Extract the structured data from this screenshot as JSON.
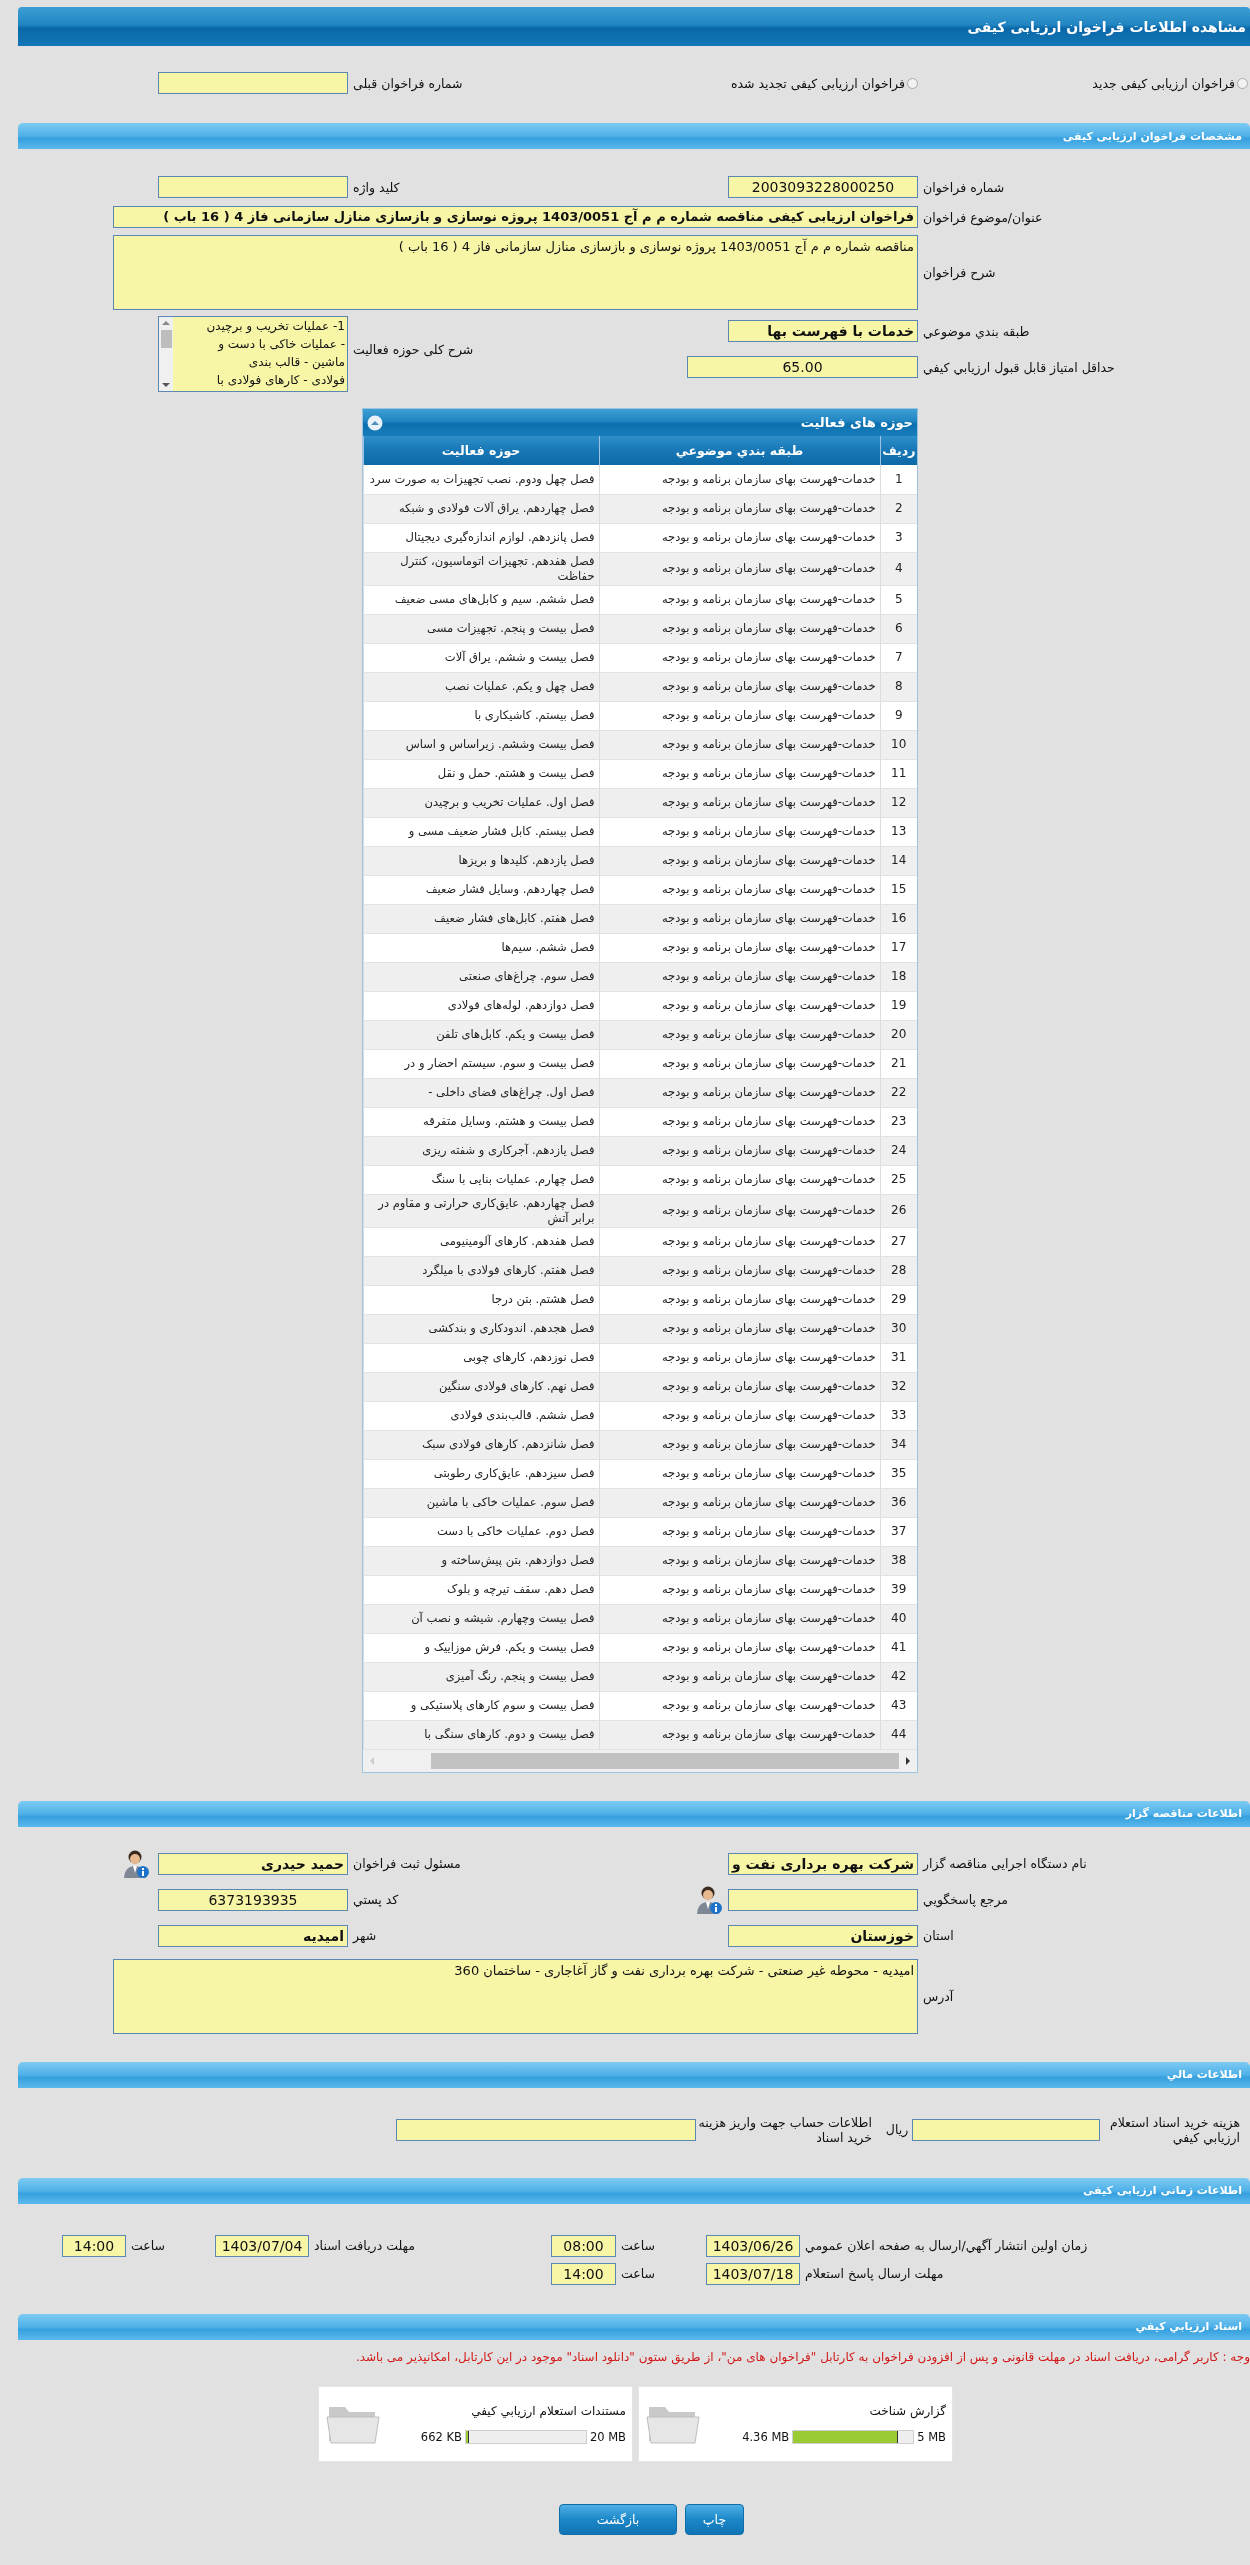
{
  "window": {
    "title": "مشاهده اطلاعات فراخوان ارزیابی کیفی"
  },
  "call_type": [
    {
      "label": "فراخوان ارزیابی کیفی جدید",
      "selected": false
    },
    {
      "label": "فراخوان ارزیابی کیفی تجدید شده",
      "selected": false
    }
  ],
  "previous_call": {
    "label": "شماره فراخوان قبلی"
  },
  "details": {
    "title": "مشخصات فراخوان ارزیابی کیفی",
    "call_number": {
      "label": "شماره فراخوان",
      "value": "2003093228000250"
    },
    "keyword": {
      "label": "کلید واژه"
    },
    "subject": {
      "label": "عنوان/موضوع فراخوان",
      "value": "فراخوان ارزیابی کیفی مناقصه شماره م م آج 1403/0051 پروژه نوسازی و بازسازی منازل سازمانی فاز 4 ( 16 باب )"
    },
    "description": {
      "label": "شرح فراخوان",
      "value": "مناقصه شماره م م آج 1403/0051 پروژه نوسازی و بازسازی منازل سازمانی فاز 4 ( 16 باب )"
    },
    "category": {
      "label": "طبقه بندي موضوعي",
      "value": "خدمات با فهرست بها"
    },
    "activity_summary": {
      "label": "شرح کلی حوزه فعالیت",
      "lines": [
        "1- عملیات تخریب و برچیدن",
        "- عملیات خاکی با دست و",
        "ماشین - قالب بندی",
        "فولادی - کارهای فولادی با"
      ]
    },
    "min_score": {
      "label": "حداقل امتياز قابل قبول ارزيابي کيفي",
      "value": "65.00"
    }
  },
  "activities": {
    "title": "حوزه های فعالیت",
    "columns": [
      "ردیف",
      "طبقه بندي موضوعي",
      "حوزه فعالیت"
    ],
    "rows": [
      [
        "1",
        "خدمات-فهرست بهای سازمان برنامه و بودجه",
        "فصل چهل ودوم. نصب تجهیزات به صورت سرد"
      ],
      [
        "2",
        "خدمات-فهرست بهای سازمان برنامه و بودجه",
        "فصل چهاردهم. یراق آلات فولادی و شبکه"
      ],
      [
        "3",
        "خدمات-فهرست بهای سازمان برنامه و بودجه",
        "فصل پانزدهم. لوازم اندازه‌گیری دیجیتال"
      ],
      [
        "4",
        "خدمات-فهرست بهای سازمان برنامه و بودجه",
        "فصل هفدهم. تجهیزات اتوماسیون، کنترل حفاظت"
      ],
      [
        "5",
        "خدمات-فهرست بهای سازمان برنامه و بودجه",
        "فصل ششم. سیم و کابل‌های مسی ضعیف"
      ],
      [
        "6",
        "خدمات-فهرست بهای سازمان برنامه و بودجه",
        "فصل بیست و پنجم. تجهیزات مسی"
      ],
      [
        "7",
        "خدمات-فهرست بهای سازمان برنامه و بودجه",
        "فصل بیست و ششم. یراق آلات"
      ],
      [
        "8",
        "خدمات-فهرست بهای سازمان برنامه و بودجه",
        "فصل چهل و یکم. عملیات نصب"
      ],
      [
        "9",
        "خدمات-فهرست بهای سازمان برنامه و بودجه",
        "فصل بیستم. کاشیکاری با"
      ],
      [
        "10",
        "خدمات-فهرست بهای سازمان برنامه و بودجه",
        "فصل بیست وششم. زیراساس و اساس"
      ],
      [
        "11",
        "خدمات-فهرست بهای سازمان برنامه و بودجه",
        "فصل بیست و هشتم. حمل و نقل"
      ],
      [
        "12",
        "خدمات-فهرست بهای سازمان برنامه و بودجه",
        "فصل اول. عملیات تخریب و برچیدن"
      ],
      [
        "13",
        "خدمات-فهرست بهای سازمان برنامه و بودجه",
        "فصل بیستم. کابل فشار ضعیف مسی و"
      ],
      [
        "14",
        "خدمات-فهرست بهای سازمان برنامه و بودجه",
        "فصل یازدهم. کلیدها و بریزها"
      ],
      [
        "15",
        "خدمات-فهرست بهای سازمان برنامه و بودجه",
        "فصل چهاردهم. وسایل فشار ضعیف"
      ],
      [
        "16",
        "خدمات-فهرست بهای سازمان برنامه و بودجه",
        "فصل هفتم. کابل‌های فشار ضعیف"
      ],
      [
        "17",
        "خدمات-فهرست بهای سازمان برنامه و بودجه",
        "فصل ششم. سیم‌ها"
      ],
      [
        "18",
        "خدمات-فهرست بهای سازمان برنامه و بودجه",
        "فصل سوم. چراغ‌های صنعتی"
      ],
      [
        "19",
        "خدمات-فهرست بهای سازمان برنامه و بودجه",
        "فصل دوازدهم. لوله‌های فولادی"
      ],
      [
        "20",
        "خدمات-فهرست بهای سازمان برنامه و بودجه",
        "فصل بیست و یکم. کابل‌های تلفن"
      ],
      [
        "21",
        "خدمات-فهرست بهای سازمان برنامه و بودجه",
        "فصل بیست و سوم. سیستم احضار و در"
      ],
      [
        "22",
        "خدمات-فهرست بهای سازمان برنامه و بودجه",
        "فصل اول. چراغ‌های فضای داخلی -"
      ],
      [
        "23",
        "خدمات-فهرست بهای سازمان برنامه و بودجه",
        "فصل بیست و هشتم. وسایل متفرقه"
      ],
      [
        "24",
        "خدمات-فهرست بهای سازمان برنامه و بودجه",
        "فصل یازدهم. آجرکاری و شفته ریزی"
      ],
      [
        "25",
        "خدمات-فهرست بهای سازمان برنامه و بودجه",
        "فصل چهارم. عملیات بنایی با سنگ"
      ],
      [
        "26",
        "خدمات-فهرست بهای سازمان برنامه و بودجه",
        "فصل چهاردهم. عایق‌کاری حرارتی و مقاوم در برابر آتش"
      ],
      [
        "27",
        "خدمات-فهرست بهای سازمان برنامه و بودجه",
        "فصل هفدهم. کارهای آلومینیومی"
      ],
      [
        "28",
        "خدمات-فهرست بهای سازمان برنامه و بودجه",
        "فصل هفتم. کارهای فولادی با میلگرد"
      ],
      [
        "29",
        "خدمات-فهرست بهای سازمان برنامه و بودجه",
        "فصل هشتم. بتن درجا"
      ],
      [
        "30",
        "خدمات-فهرست بهای سازمان برنامه و بودجه",
        "فصل هجدهم. اندودکاری و بندکشی"
      ],
      [
        "31",
        "خدمات-فهرست بهای سازمان برنامه و بودجه",
        "فصل نوزدهم. کارهای چوبی"
      ],
      [
        "32",
        "خدمات-فهرست بهای سازمان برنامه و بودجه",
        "فصل نهم. کارهای فولادی سنگین"
      ],
      [
        "33",
        "خدمات-فهرست بهای سازمان برنامه و بودجه",
        "فصل ششم. قالب‌بندی فولادی"
      ],
      [
        "34",
        "خدمات-فهرست بهای سازمان برنامه و بودجه",
        "فصل شانزدهم. کارهای فولادی سبک"
      ],
      [
        "35",
        "خدمات-فهرست بهای سازمان برنامه و بودجه",
        "فصل سیزدهم. عایق‌کاری رطوبتی"
      ],
      [
        "36",
        "خدمات-فهرست بهای سازمان برنامه و بودجه",
        "فصل سوم. عملیات خاکی با ماشین"
      ],
      [
        "37",
        "خدمات-فهرست بهای سازمان برنامه و بودجه",
        "فصل دوم. عملیات خاکی با دست"
      ],
      [
        "38",
        "خدمات-فهرست بهای سازمان برنامه و بودجه",
        "فصل دوازدهم. بتن پیش‌ساخته و"
      ],
      [
        "39",
        "خدمات-فهرست بهای سازمان برنامه و بودجه",
        "فصل دهم. سقف تیرچه و بلوک"
      ],
      [
        "40",
        "خدمات-فهرست بهای سازمان برنامه و بودجه",
        "فصل بیست وچهارم. شیشه و نصب آن"
      ],
      [
        "41",
        "خدمات-فهرست بهای سازمان برنامه و بودجه",
        "فصل بیست و یکم. فرش موزاییک و"
      ],
      [
        "42",
        "خدمات-فهرست بهای سازمان برنامه و بودجه",
        "فصل بیست و پنجم. رنگ آمیزی"
      ],
      [
        "43",
        "خدمات-فهرست بهای سازمان برنامه و بودجه",
        "فصل بیست و سوم کارهای پلاستیکی و"
      ],
      [
        "44",
        "خدمات-فهرست بهای سازمان برنامه و بودجه",
        "فصل بیست و دوم. کارهای سنگی با"
      ]
    ]
  },
  "tenderer": {
    "title": "اطلاعات مناقصه گزار",
    "organization": {
      "label": "نام دستگاه اجرایی مناقصه گزار",
      "value": "شرکت بهره برداری نفت و"
    },
    "registrar": {
      "label": "مسئول ثبت فراخوان",
      "value": "حمید حیدری"
    },
    "contact": {
      "label": "مرجع پاسخگويي"
    },
    "postal_code": {
      "label": "کد پستي",
      "value": "6373193935"
    },
    "province": {
      "label": "استان",
      "value": "خوزستان"
    },
    "city": {
      "label": "شهر",
      "value": "امیدیه"
    },
    "address": {
      "label": "آدرس",
      "value": "امیدیه - محوطه غیر صنعتی - شرکت بهره برداری نفت و گاز آغاجاری - ساختمان 360"
    }
  },
  "financial": {
    "title": "اطلاعات مالي",
    "document_fee": {
      "label": "هزینه خرید اسناد استعلام ارزيابي کيفي",
      "unit": "ريال"
    },
    "account": {
      "label": "اطلاعات حساب جهت واريز هزینه خرید اسناد"
    }
  },
  "timing": {
    "title": "اطلاعات زمانی ارزیابی کیفی",
    "items": [
      {
        "label": "زمان اولين انتشار آگهي/ارسال به صفحه اعلان عمومي",
        "date": "1403/06/26",
        "time_label": "ساعت",
        "time": "08:00"
      },
      {
        "label": "مهلت دریافت اسناد",
        "date": "1403/07/04",
        "time_label": "ساعت",
        "time": "14:00"
      },
      {
        "label": "مهلت ارسال پاسخ استعلام",
        "date": "1403/07/18",
        "time_label": "ساعت",
        "time": "14:00"
      }
    ]
  },
  "documents": {
    "title": "اسناد ارزيابي کيفي",
    "note": "وجه : کاربر گرامی، دریافت اسناد در مهلت قانونی و پس از افزودن فراخوان به کارتابل \"فراخوان های من\"، از طریق ستون \"دانلود اسناد\" موجود در این کارتابل، امکانپذیر می باشد.",
    "files": [
      {
        "name": "گزارش شناخت",
        "capacity": "5 MB",
        "used": "4.36 MB",
        "level": 0.87
      },
      {
        "name": "مستندات استعلام ارزيابي کيفي",
        "capacity": "20 MB",
        "used": "662 KB",
        "level": 0.03
      }
    ]
  },
  "buttons": [
    "چاپ",
    "بازگشت"
  ]
}
